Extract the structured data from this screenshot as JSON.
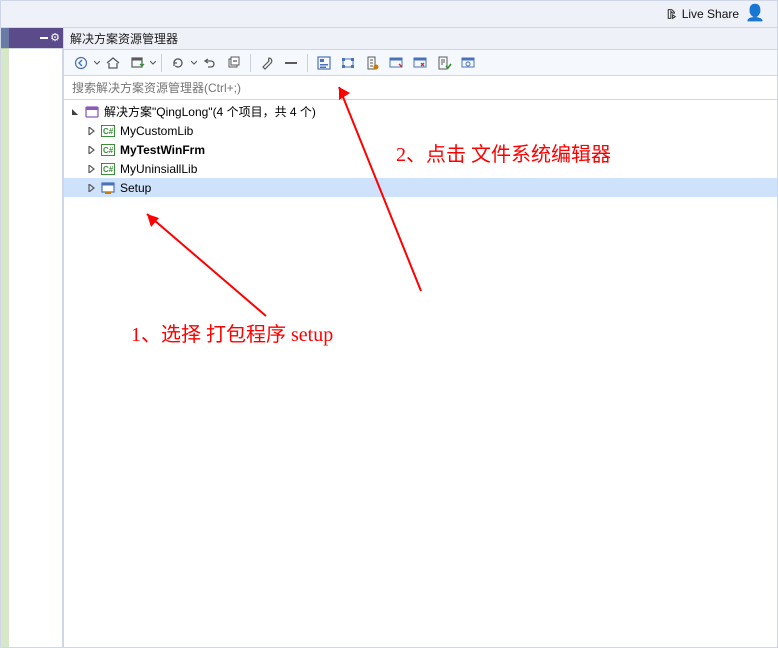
{
  "topbar": {
    "live_share_label": "Live Share"
  },
  "panel": {
    "title": "解决方案资源管理器",
    "search_placeholder": "搜索解决方案资源管理器(Ctrl+;)"
  },
  "solution": {
    "label": "解决方案\"QingLong\"(4 个项目，共 4 个)",
    "items": [
      {
        "label": "MyCustomLib",
        "bold": false,
        "icon": "cs"
      },
      {
        "label": "MyTestWinFrm",
        "bold": true,
        "icon": "cs"
      },
      {
        "label": "MyUninsiallLib",
        "bold": false,
        "icon": "cs"
      },
      {
        "label": "Setup",
        "bold": false,
        "icon": "setup"
      }
    ]
  },
  "annotations": {
    "a1": "1、选择 打包程序 setup",
    "a2": "2、点击 文件系统编辑器"
  }
}
